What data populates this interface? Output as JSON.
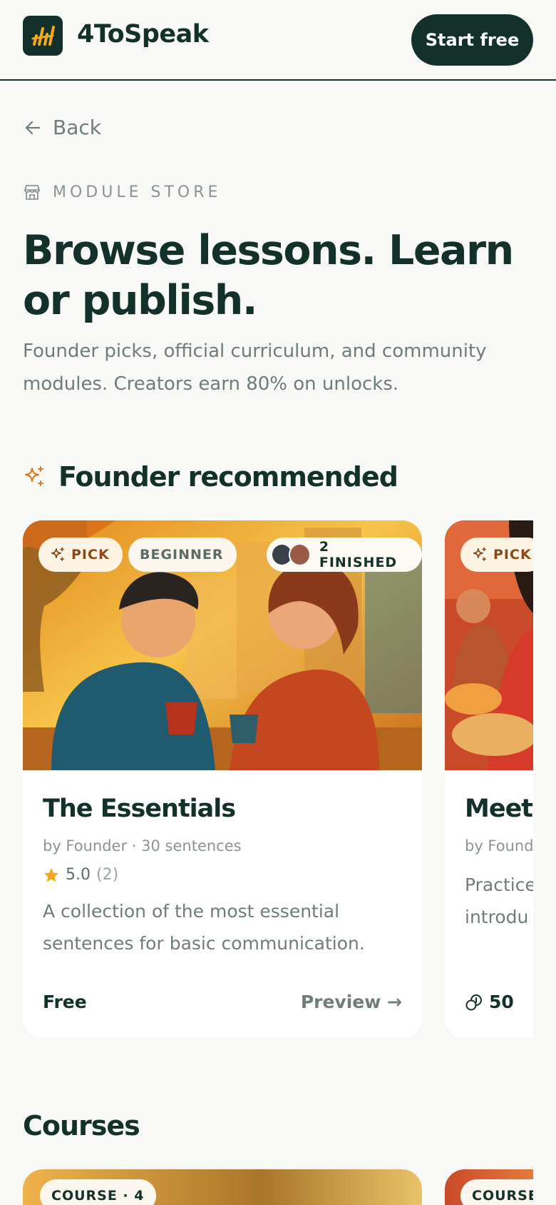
{
  "header": {
    "brand": "4ToSpeak",
    "logo_icon": "bars-logo-icon",
    "start_label": "Start free"
  },
  "nav": {
    "back_label": "Back"
  },
  "hero": {
    "eyebrow": "MODULE STORE",
    "title": "Browse lessons. Learn or publish.",
    "subtitle": "Founder picks, official curriculum, and community modules. Creators earn 80% on unlocks."
  },
  "founder_section": {
    "heading": "Founder recommended",
    "cards": [
      {
        "pick_label": "PICK",
        "level": "BEGINNER",
        "finished": "2 FINISHED",
        "title": "The Essentials",
        "meta": "by Founder · 30 sentences",
        "rating": "5.0",
        "rating_count": "(2)",
        "description": "A collection of the most essential sentences for basic communication.",
        "price": "Free",
        "cta": "Preview →"
      },
      {
        "pick_label": "PICK",
        "title": "Meeti",
        "meta": "by Found",
        "description_l1": "Practice",
        "description_l2": "introdu",
        "price": "50"
      }
    ]
  },
  "courses_section": {
    "heading": "Courses",
    "cards": [
      {
        "chip": "COURSE · 4"
      },
      {
        "chip": "COURSE"
      }
    ]
  },
  "colors": {
    "brand_dark": "#13302a",
    "accent_orange": "#e07a1f",
    "muted_text": "#6e7d78",
    "background": "#f8f8f6",
    "star": "#f2a91c"
  }
}
